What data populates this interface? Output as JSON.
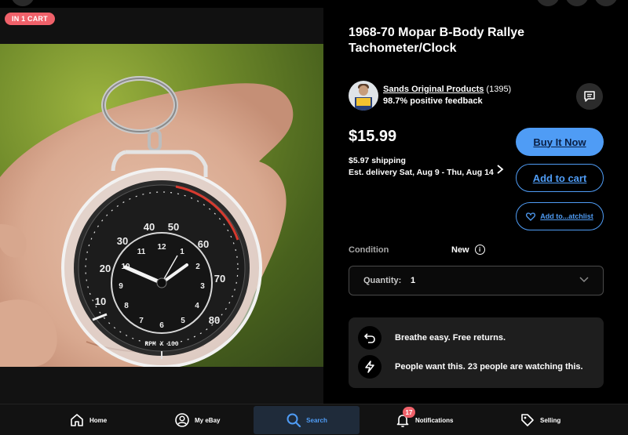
{
  "badge": {
    "cart": "IN 1 CART"
  },
  "product": {
    "title": "1968-70 Mopar B-Body Rallye Tachometer/Clock",
    "price": "$15.99",
    "shipping": "$5.97 shipping",
    "delivery": "Est. delivery Sat, Aug 9 - Thu, Aug 14"
  },
  "seller": {
    "name": "Sands Original Products",
    "count": "(1395)",
    "feedback": "98.7% positive feedback"
  },
  "actions": {
    "buy_now": "Buy It Now",
    "add_to_cart": "Add to cart",
    "watchlist": "Add to...atchlist"
  },
  "details": {
    "condition_label": "Condition",
    "condition_value": "New",
    "quantity_label": "Quantity:",
    "quantity_value": "1"
  },
  "promos": [
    {
      "icon": "return-arrow-icon",
      "text": "Breathe easy. Free returns."
    },
    {
      "icon": "lightning-icon",
      "text": "People want this. 23 people are watching this."
    }
  ],
  "gauge": {
    "rpm_labels": [
      "10",
      "20",
      "30",
      "40",
      "50",
      "60",
      "70",
      "80"
    ],
    "clock_labels": [
      "12",
      "1",
      "2",
      "3",
      "4",
      "5",
      "6",
      "7",
      "8",
      "9",
      "10",
      "11"
    ],
    "legend": "RPM X 100"
  },
  "nav": {
    "home": "Home",
    "my_ebay": "My eBay",
    "search": "Search",
    "notifications": "Notifications",
    "notifications_count": "17",
    "selling": "Selling"
  },
  "colors": {
    "accent": "#4f9cf5",
    "badge": "#f0616a",
    "background": "#000000"
  }
}
